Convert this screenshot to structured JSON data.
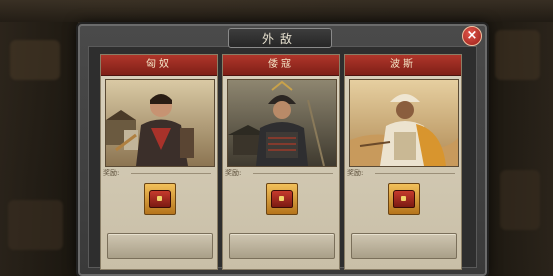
{
  "dialog": {
    "title": "外敌",
    "close_label": "×"
  },
  "cards": [
    {
      "name": "匈奴",
      "reward_label": "奖励:",
      "button_line1": "",
      "button_line2": ""
    },
    {
      "name": "倭寇",
      "reward_label": "奖励:",
      "button_line1": "",
      "button_line2": ""
    },
    {
      "name": "波斯",
      "reward_label": "奖励:",
      "button_line1": "",
      "button_line2": ""
    }
  ],
  "colors": {
    "header_red": "#9a2a20",
    "card_bg": "#d3cab4",
    "modal_bg": "#3a3a3a"
  },
  "icons": [
    "close-icon",
    "treasure-chest-icon"
  ]
}
